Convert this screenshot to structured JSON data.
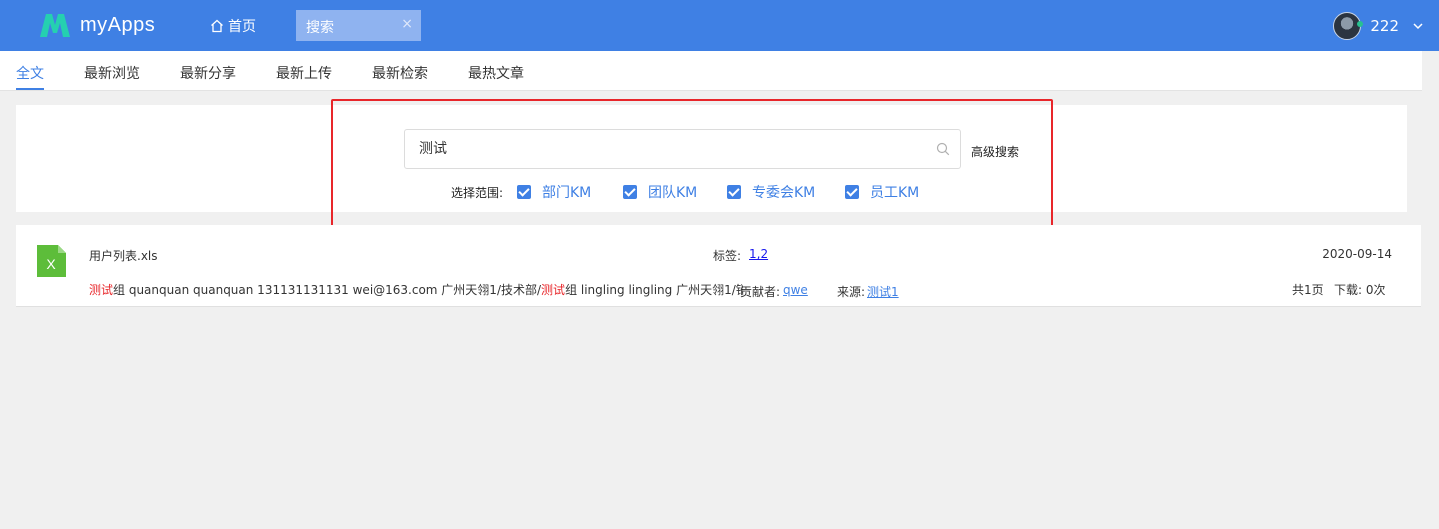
{
  "app": {
    "name": "myApps",
    "brand_color": "#3f80e4"
  },
  "topnav": {
    "home_label": "首页",
    "active_tab": "搜索",
    "close_symbol": "×"
  },
  "user": {
    "name": "222"
  },
  "subnav": {
    "items": [
      "全文",
      "最新浏览",
      "最新分享",
      "最新上传",
      "最新检索",
      "最热文章"
    ],
    "active_index": 0
  },
  "search": {
    "query": "测试",
    "advanced_label": "高级搜索",
    "scope_label": "选择范围:",
    "scopes": [
      {
        "label": "部门KM",
        "checked": true
      },
      {
        "label": "团队KM",
        "checked": true
      },
      {
        "label": "专委会KM",
        "checked": true
      },
      {
        "label": "员工KM",
        "checked": true
      }
    ]
  },
  "result": {
    "file_name": "用户列表.xls",
    "file_icon": "excel-file-icon",
    "file_icon_letter": "X",
    "tags_label": "标签:",
    "tags_value": "1,2",
    "date": "2020-09-14",
    "snippet_parts": [
      {
        "text": "测试",
        "hl": true
      },
      {
        "text": "组 quanquan quanquan 131131131131 wei@163.com 广州天翎1/技术部/",
        "hl": false
      },
      {
        "text": "测试",
        "hl": true
      },
      {
        "text": "组 lingling lingling 广州天翎1/销...",
        "hl": false
      }
    ],
    "contributor_label": "贡献者:",
    "contributor": "qwe",
    "source_label": "来源:",
    "source": "测试1",
    "pages": "共1页",
    "downloads": "下载:    0次"
  }
}
